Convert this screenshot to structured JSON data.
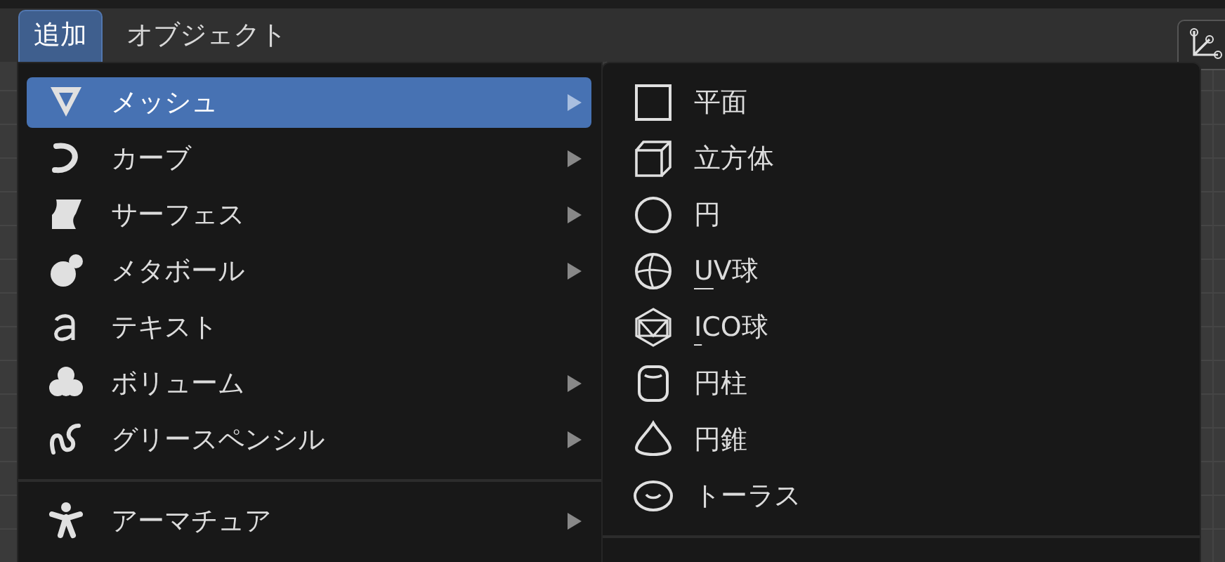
{
  "header": {
    "tabs": [
      {
        "label": "追加",
        "selected": true
      },
      {
        "label": "オブジェクト",
        "selected": false
      }
    ]
  },
  "menu": {
    "items": [
      {
        "kind": "item",
        "label": "メッシュ",
        "selected": true,
        "submenu": true
      },
      {
        "kind": "item",
        "label": "カーブ",
        "selected": false,
        "submenu": true
      },
      {
        "kind": "item",
        "label": "サーフェス",
        "selected": false,
        "submenu": true
      },
      {
        "kind": "item",
        "label": "メタボール",
        "selected": false,
        "submenu": true
      },
      {
        "kind": "item",
        "label": "テキスト",
        "selected": false,
        "submenu": false
      },
      {
        "kind": "item",
        "label": "ボリューム",
        "selected": false,
        "submenu": true
      },
      {
        "kind": "item",
        "label": "グリースペンシル",
        "selected": false,
        "submenu": true
      },
      {
        "kind": "separator"
      },
      {
        "kind": "item",
        "label": "アーマチュア",
        "selected": false,
        "submenu": true
      }
    ]
  },
  "submenu": {
    "items": [
      {
        "kind": "item",
        "label": "平面",
        "first_letter_underlined": false
      },
      {
        "kind": "item",
        "label": "立方体",
        "first_letter_underlined": false
      },
      {
        "kind": "item",
        "label": "円",
        "first_letter_underlined": false
      },
      {
        "kind": "item",
        "label": "UV球",
        "first_letter_underlined": true
      },
      {
        "kind": "item",
        "label": "ICO球",
        "first_letter_underlined": true
      },
      {
        "kind": "item",
        "label": "円柱",
        "first_letter_underlined": false
      },
      {
        "kind": "item",
        "label": "円錐",
        "first_letter_underlined": false
      },
      {
        "kind": "item",
        "label": "トーラス",
        "first_letter_underlined": false
      },
      {
        "kind": "separator"
      }
    ]
  }
}
